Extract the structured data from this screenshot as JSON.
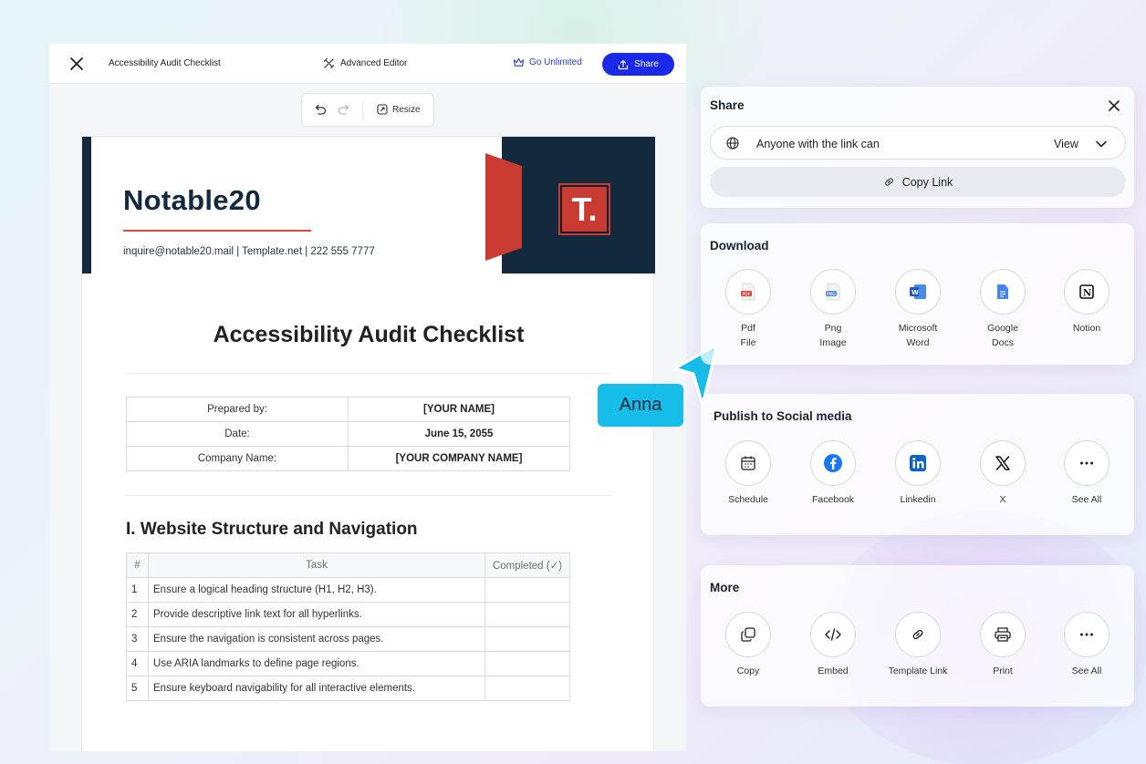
{
  "editor": {
    "title": "Accessibility Audit Checklist",
    "advanced_editor": "Advanced Editor",
    "go_unlimited": "Go Unlimited",
    "share": "Share",
    "resize": "Resize"
  },
  "document": {
    "brand": "Notable20",
    "contact": "inquire@notable20.mail  |  Template.net  |  222 555 7777",
    "logo_letter": "T.",
    "title": "Accessibility Audit Checklist",
    "info": [
      {
        "label": "Prepared by:",
        "value": "[YOUR NAME]"
      },
      {
        "label": "Date:",
        "value": "June 15, 2055"
      },
      {
        "label": "Company Name:",
        "value": "[YOUR COMPANY NAME]"
      }
    ],
    "section_title": "I. Website Structure and Navigation",
    "task_headers": [
      "#",
      "Task",
      "Completed (✓)"
    ],
    "tasks": [
      {
        "n": "1",
        "task": "Ensure a logical heading structure (H1, H2, H3)."
      },
      {
        "n": "2",
        "task": "Provide descriptive link text for all hyperlinks."
      },
      {
        "n": "3",
        "task": "Ensure the navigation is consistent across pages."
      },
      {
        "n": "4",
        "task": "Use ARIA landmarks to define page regions."
      },
      {
        "n": "5",
        "task": "Ensure keyboard navigability for all interactive elements."
      }
    ]
  },
  "cursor": {
    "name": "Anna",
    "color": "#16bde8"
  },
  "share_panel": {
    "title": "Share",
    "access_text": "Anyone with the link can",
    "access_level": "View",
    "copy_link": "Copy Link"
  },
  "download": {
    "title": "Download",
    "items": [
      {
        "line1": "Pdf",
        "line2": "File",
        "icon": "pdf-icon"
      },
      {
        "line1": "Png",
        "line2": "Image",
        "icon": "png-icon"
      },
      {
        "line1": "Microsoft",
        "line2": "Word",
        "icon": "word-icon"
      },
      {
        "line1": "Google",
        "line2": "Docs",
        "icon": "google-docs-icon"
      },
      {
        "line1": "Notion",
        "line2": "",
        "icon": "notion-icon"
      }
    ]
  },
  "social": {
    "title": "Publish to Social media",
    "items": [
      "Schedule",
      "Facebook",
      "Linkedin",
      "X",
      "See All"
    ]
  },
  "more": {
    "title": "More",
    "items": [
      "Copy",
      "Embed",
      "Template Link",
      "Print",
      "See All"
    ]
  },
  "colors": {
    "accent": "#1a2ae8",
    "brand_dark": "#13293d",
    "brand_red": "#c93a30"
  }
}
